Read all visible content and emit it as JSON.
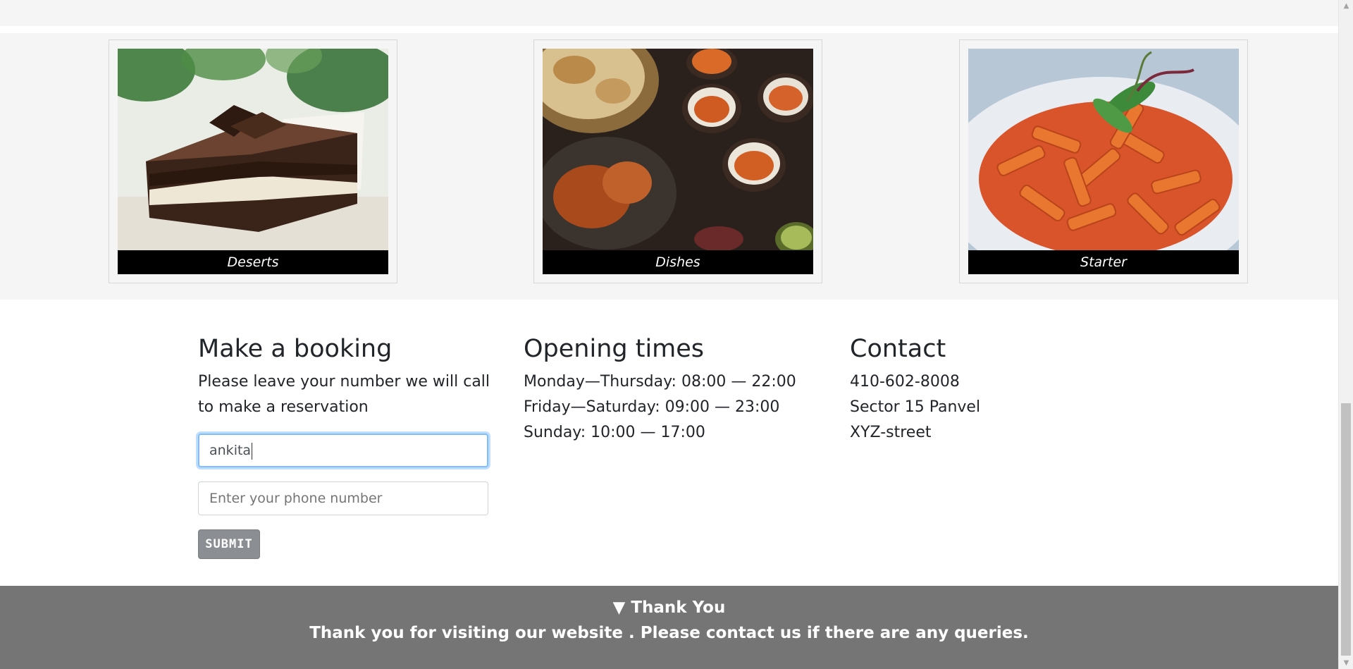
{
  "gallery": {
    "cards": [
      {
        "caption": "Deserts",
        "image": "chocolate-cake-slice"
      },
      {
        "caption": "Dishes",
        "image": "indian-dishes-with-naan"
      },
      {
        "caption": "Starter",
        "image": "penne-pasta-plate"
      }
    ]
  },
  "booking": {
    "title": "Make a booking",
    "description": "Please leave your number we will call to make a reservation",
    "name_value": "ankita",
    "phone_placeholder": "Enter your phone number",
    "submit_label": "SUBMIT"
  },
  "opening": {
    "title": "Opening times",
    "lines": [
      "Monday—Thursday: 08:00 — 22:00",
      "Friday—Saturday: 09:00 — 23:00",
      "Sunday: 10:00 — 17:00"
    ]
  },
  "contact": {
    "title": "Contact",
    "lines": [
      "410-602-8008",
      "Sector 15 Panvel",
      "XYZ-street"
    ]
  },
  "footer": {
    "summary": "▼ Thank You",
    "message": "Thank you for visiting our website . Please contact us if there are any queries."
  },
  "colors": {
    "footer_bg": "#757575",
    "caption_bg": "#000000",
    "focus_border": "#80bdff",
    "submit_bg": "#8b8f94"
  }
}
